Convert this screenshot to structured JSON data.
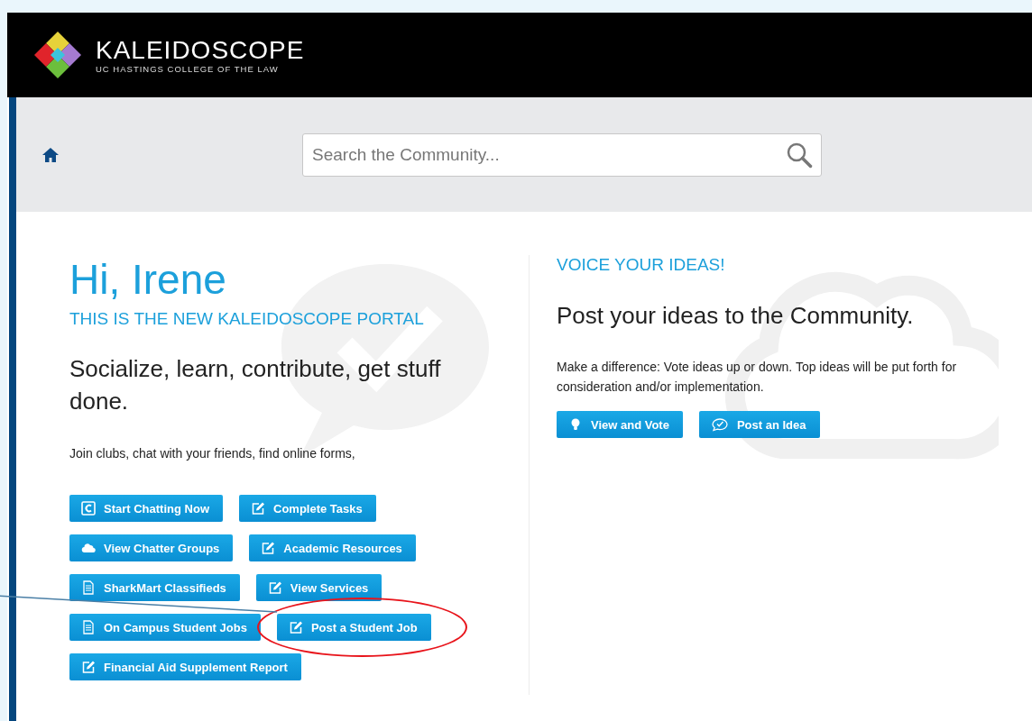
{
  "header": {
    "brand": "KALEIDOSCOPE",
    "subtitle": "UC HASTINGS COLLEGE OF THE LAW"
  },
  "search": {
    "placeholder": "Search the Community..."
  },
  "welcome": {
    "greeting": "Hi, Irene",
    "subheading": "THIS IS THE NEW KALEIDOSCOPE PORTAL",
    "tagline": "Socialize, learn, contribute, get stuff done.",
    "intro": "Join clubs, chat with your friends, find online forms,"
  },
  "button_rows": [
    [
      {
        "label": "Start Chatting Now",
        "kind": "chatter",
        "annotated": false
      },
      {
        "label": "Complete Tasks",
        "kind": "edit",
        "annotated": false
      }
    ],
    [
      {
        "label": "View Chatter Groups",
        "kind": "cloud",
        "annotated": false
      },
      {
        "label": "Academic Resources",
        "kind": "edit",
        "annotated": false
      }
    ],
    [
      {
        "label": "SharkMart Classifieds",
        "kind": "document",
        "annotated": false
      },
      {
        "label": "View Services",
        "kind": "edit",
        "annotated": false
      }
    ],
    [
      {
        "label": "On Campus Student Jobs",
        "kind": "document",
        "annotated": false
      },
      {
        "label": "Post a Student Job",
        "kind": "edit",
        "annotated": true
      }
    ],
    [
      {
        "label": "Financial Aid Supplement Report",
        "kind": "edit",
        "annotated": false
      }
    ]
  ],
  "ideas": {
    "heading": "VOICE YOUR IDEAS!",
    "title": "Post your ideas to the Community.",
    "text": "Make a difference: Vote ideas up or down. Top ideas will be put forth for consideration and/or implementation.",
    "buttons": [
      {
        "label": "View and Vote",
        "kind": "bulb"
      },
      {
        "label": "Post an Idea",
        "kind": "chat-check"
      }
    ]
  }
}
